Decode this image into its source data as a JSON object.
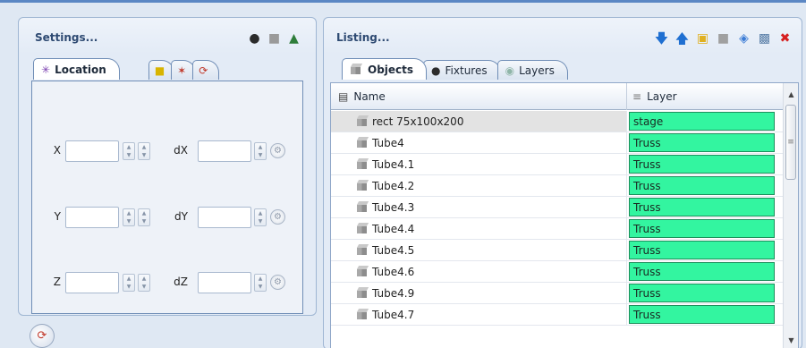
{
  "settings": {
    "title": "Settings...",
    "header_icons": [
      "fixture-icon",
      "cube-icon",
      "truss-icon"
    ],
    "tabs": [
      {
        "label": "Location",
        "icon": "location-axes-icon",
        "active": true
      },
      {
        "label": "",
        "icon": "ruler-icon",
        "active": false
      },
      {
        "label": "",
        "icon": "colors-icon",
        "active": false
      },
      {
        "label": "",
        "icon": "rotate-icon",
        "active": false
      }
    ],
    "fields": [
      {
        "label": "X",
        "value": "",
        "delta_label": "dX",
        "delta_value": ""
      },
      {
        "label": "Y",
        "value": "",
        "delta_label": "dY",
        "delta_value": ""
      },
      {
        "label": "Z",
        "value": "",
        "delta_label": "dZ",
        "delta_value": ""
      }
    ]
  },
  "listing": {
    "title": "Listing...",
    "toolbar": [
      "move-down-icon",
      "move-up-icon",
      "new-folder-icon",
      "new-object-icon",
      "link-icon",
      "save-icon",
      "delete-icon"
    ],
    "tabs": [
      {
        "label": "Objects",
        "active": true
      },
      {
        "label": "Fixtures",
        "active": false
      },
      {
        "label": "Layers",
        "active": false
      }
    ],
    "columns": {
      "name": "Name",
      "layer": "Layer"
    },
    "rows": [
      {
        "name": "rect 75x100x200",
        "layer": "stage",
        "selected": true
      },
      {
        "name": "Tube4",
        "layer": "Truss"
      },
      {
        "name": "Tube4.1",
        "layer": "Truss"
      },
      {
        "name": "Tube4.2",
        "layer": "Truss"
      },
      {
        "name": "Tube4.3",
        "layer": "Truss"
      },
      {
        "name": "Tube4.4",
        "layer": "Truss"
      },
      {
        "name": "Tube4.5",
        "layer": "Truss"
      },
      {
        "name": "Tube4.6",
        "layer": "Truss"
      },
      {
        "name": "Tube4.9",
        "layer": "Truss"
      },
      {
        "name": "Tube4.7",
        "layer": "Truss"
      }
    ],
    "layer_color": "#33f5a0"
  }
}
